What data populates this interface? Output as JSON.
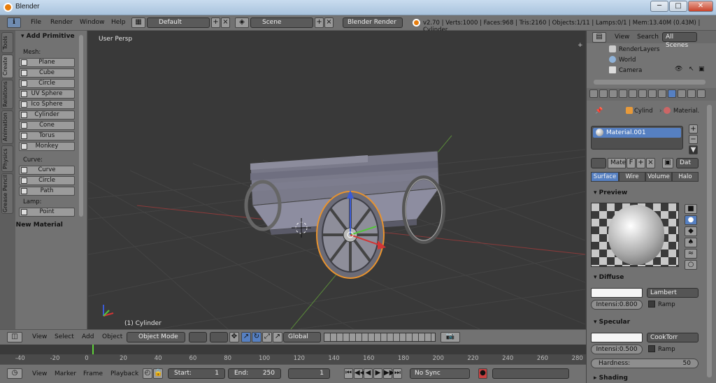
{
  "window": {
    "title": "Blender",
    "minimize": "─",
    "maximize": "□",
    "close": "✕"
  },
  "info_header": {
    "menus": [
      "File",
      "Render",
      "Window",
      "Help"
    ],
    "screen_layout": "Default",
    "scene": "Scene",
    "render_engine": "Blender Render",
    "stats": "v2.70 | Verts:1000 | Faces:968 | Tris:2160 | Objects:1/11 | Lamps:0/1 | Mem:13.40M (0.43M) | Cylinder"
  },
  "toolshelf": {
    "tabs": [
      "Tools",
      "Create",
      "Relations",
      "Animation",
      "Physics",
      "Grease Pencil"
    ],
    "panel_title": "Add Primitive",
    "mesh_label": "Mesh:",
    "mesh_buttons": [
      "Plane",
      "Cube",
      "Circle",
      "UV Sphere",
      "Ico Sphere",
      "Cylinder",
      "Cone",
      "Torus",
      "Monkey"
    ],
    "curve_label": "Curve:",
    "curve_buttons": [
      "Curve",
      "Circle",
      "Path"
    ],
    "lamp_label": "Lamp:",
    "lamp_buttons": [
      "Point"
    ],
    "new_material": "New Material"
  },
  "viewport": {
    "view_name": "User Persp",
    "object_label": "(1) Cylinder"
  },
  "outliner": {
    "menus": [
      "View",
      "Search"
    ],
    "filter": "All Scenes",
    "items": [
      "RenderLayers",
      "World",
      "Camera"
    ]
  },
  "properties": {
    "breadcrumb": [
      "Cylind",
      "Material."
    ],
    "material_slot": "Material.001",
    "datablock_name": "Mate",
    "datablock_f": "F",
    "link": "Dat",
    "tabs": [
      "Surface",
      "Wire",
      "Volume",
      "Halo"
    ],
    "preview_title": "Preview",
    "diffuse_title": "Diffuse",
    "diffuse_shader": "Lambert",
    "diffuse_intensity": "Intensi:0.800",
    "ramp": "Ramp",
    "specular_title": "Specular",
    "specular_shader": "CookTorr",
    "specular_intensity": "Intensi:0.500",
    "hardness_label": "Hardness:",
    "hardness_value": "50",
    "shading_title": "Shading"
  },
  "viewport_header": {
    "menus": [
      "View",
      "Select",
      "Add",
      "Object"
    ],
    "mode": "Object Mode",
    "orientation": "Global"
  },
  "timeline": {
    "ticks": [
      "-40",
      "-20",
      "0",
      "20",
      "40",
      "60",
      "80",
      "100",
      "120",
      "140",
      "160",
      "180",
      "200",
      "220",
      "240",
      "260",
      "280"
    ],
    "current_frame_value": 1
  },
  "timeline_header": {
    "menus": [
      "View",
      "Marker",
      "Frame",
      "Playback"
    ],
    "start_label": "Start:",
    "start_value": "1",
    "end_label": "End:",
    "end_value": "250",
    "current_frame": "1",
    "sync": "No Sync"
  },
  "colors": {
    "accent": "#5680c2",
    "selection": "#e8932f",
    "grid_x": "#8a3a3a",
    "grid_y": "#5a8a3a",
    "frame_marker": "#5fd13a"
  }
}
